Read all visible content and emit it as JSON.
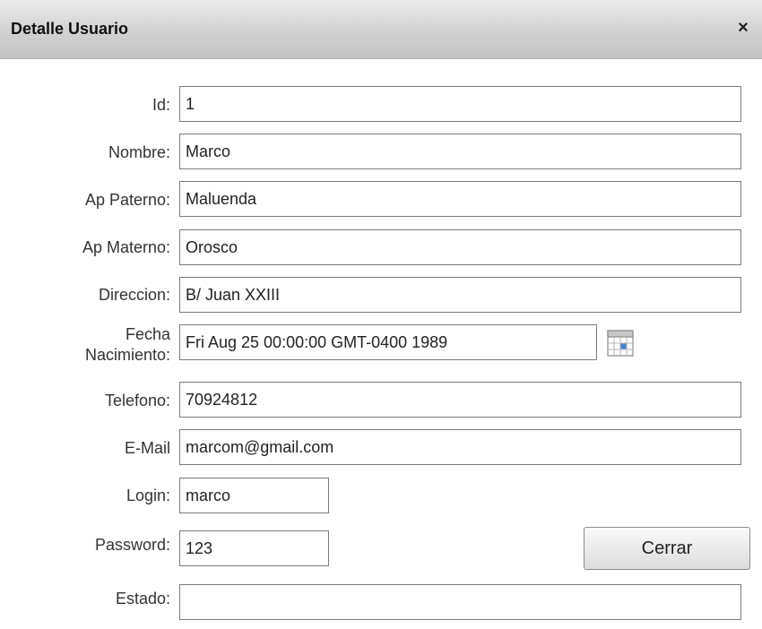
{
  "dialog": {
    "title": "Detalle Usuario",
    "close_glyph": "×"
  },
  "form": {
    "id": {
      "label": "Id:",
      "value": "1"
    },
    "nombre": {
      "label": "Nombre:",
      "value": "Marco"
    },
    "ap_paterno": {
      "label": "Ap Paterno:",
      "value": "Maluenda"
    },
    "ap_materno": {
      "label": "Ap Materno:",
      "value": "Orosco"
    },
    "direccion": {
      "label": "Direccion:",
      "value": "B/ Juan XXIII"
    },
    "fecha_nacimiento": {
      "label_line1": "Fecha",
      "label_line2": "Nacimiento:",
      "value": "Fri Aug 25 00:00:00 GMT-0400 1989",
      "icon": "calendar-icon"
    },
    "telefono": {
      "label": "Telefono:",
      "value": "70924812"
    },
    "email": {
      "label": "E-Mail",
      "value": "marcom@gmail.com"
    },
    "login": {
      "label": "Login:",
      "value": "marco"
    },
    "password": {
      "label": "Password:",
      "value": "123"
    },
    "estado": {
      "label": "Estado:",
      "value": ""
    }
  },
  "buttons": {
    "cerrar": "Cerrar"
  }
}
